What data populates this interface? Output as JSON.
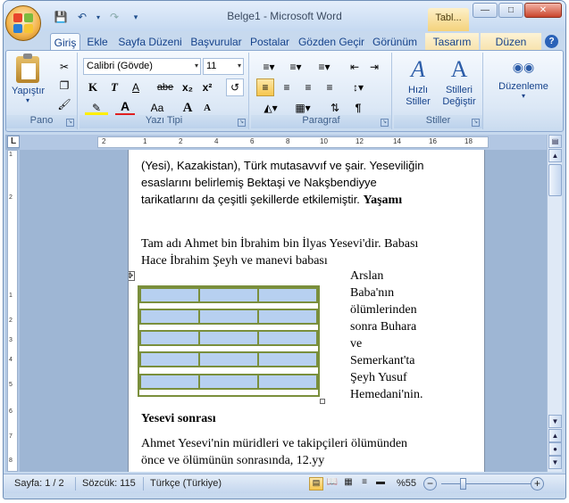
{
  "window": {
    "title": "Belge1 - Microsoft Word",
    "context_tab": "Tabl..."
  },
  "tabs": [
    "Giriş",
    "Ekle",
    "Sayfa Düzeni",
    "Başvurular",
    "Postalar",
    "Gözden Geçir",
    "Görünüm",
    "Tasarım",
    "Düzen"
  ],
  "ribbon": {
    "pano": {
      "label": "Pano",
      "paste": "Yapıştır"
    },
    "font": {
      "label": "Yazı Tipi",
      "name": "Calibri (Gövde)",
      "size": "11",
      "bold": "K",
      "italic": "T",
      "underline": "A",
      "strike": "abe",
      "sub": "x₂",
      "sup": "x²",
      "aa": "Aa",
      "grow": "A",
      "shrink": "A"
    },
    "paragraph": {
      "label": "Paragraf"
    },
    "styles": {
      "label": "Stiller",
      "quick": "Hızlı Stiller",
      "change": "Stilleri Değiştir"
    },
    "editing": {
      "label": "Düzenleme"
    }
  },
  "ruler": {
    "h": [
      "2",
      "1",
      "2",
      "4",
      "6",
      "8",
      "10",
      "12",
      "14",
      "16",
      "18"
    ],
    "v": [
      "1",
      "2",
      "1",
      "2",
      "3",
      "4",
      "5",
      "6",
      "7",
      "8"
    ]
  },
  "document": {
    "para1": "(Yesi), Kazakistan), Türk mutasavvıf ve şair. Yeseviliğin esaslarını belirlemiş Bektaşi ve Nakşbendiyye tarikatlarını da çeşitli şekillerde etkilemiştir.",
    "heading1": "Yaşamı",
    "para2": "Tam adı Ahmet bin İbrahim bin İlyas Yesevi'dir. Babası Hace İbrahim Şeyh ve manevi babası",
    "side_text": [
      "Arslan",
      "Baba'nın",
      "ölümlerinden",
      "sonra Buhara",
      "ve",
      "Semerkant'ta",
      "Şeyh Yusuf",
      "Hemedani'nin."
    ],
    "heading2": "Yesevi sonrası",
    "para3": "Ahmet Yesevi'nin müridleri ve takipçileri ölümünden önce ve ölümünün sonrasında, 12.yy"
  },
  "status": {
    "page": "Sayfa: 1 / 2",
    "words": "Sözcük: 115",
    "lang": "Türkçe (Türkiye)",
    "zoom": "%55"
  }
}
